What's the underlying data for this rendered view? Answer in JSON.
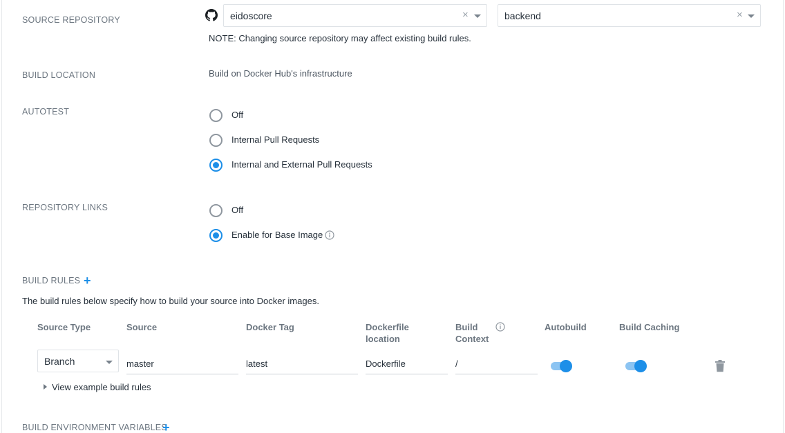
{
  "source_repository": {
    "label": "SOURCE REPOSITORY",
    "provider_icon": "github-icon",
    "organization": {
      "value": "eidoscore",
      "clear_glyph": "×"
    },
    "repository": {
      "value": "backend",
      "clear_glyph": "×"
    },
    "note": "NOTE: Changing source repository may affect existing build rules."
  },
  "build_location": {
    "label": "BUILD LOCATION",
    "value": "Build on Docker Hub's infrastructure"
  },
  "autotest": {
    "label": "AUTOTEST",
    "options": [
      {
        "label": "Off",
        "checked": false
      },
      {
        "label": "Internal Pull Requests",
        "checked": false
      },
      {
        "label": "Internal and External Pull Requests",
        "checked": true
      }
    ]
  },
  "repository_links": {
    "label": "REPOSITORY LINKS",
    "options": [
      {
        "label": "Off",
        "checked": false
      },
      {
        "label": "Enable for Base Image",
        "checked": true,
        "icon": "info-icon"
      }
    ]
  },
  "build_rules": {
    "label": "BUILD RULES",
    "add_glyph": "+",
    "description": "The build rules below specify how to build your source into Docker images.",
    "columns": {
      "source_type": "Source Type",
      "source": "Source",
      "docker_tag": "Docker Tag",
      "dockerfile_location_1": "Dockerfile",
      "dockerfile_location_2": "location",
      "build_context_1": "Build",
      "build_context_2": "Context",
      "autobuild": "Autobuild",
      "build_caching": "Build Caching"
    },
    "rows": [
      {
        "source_type": "Branch",
        "source": "master",
        "docker_tag": "latest",
        "dockerfile_location": "Dockerfile",
        "build_context": "/",
        "autobuild": true,
        "build_caching": true
      }
    ],
    "view_example": "View example build rules"
  },
  "build_env_vars": {
    "label": "BUILD ENVIRONMENT VARIABLES",
    "add_glyph": "+"
  },
  "colors": {
    "accent": "#1d8fe8",
    "label": "#6c7680",
    "text": "#27313b"
  }
}
